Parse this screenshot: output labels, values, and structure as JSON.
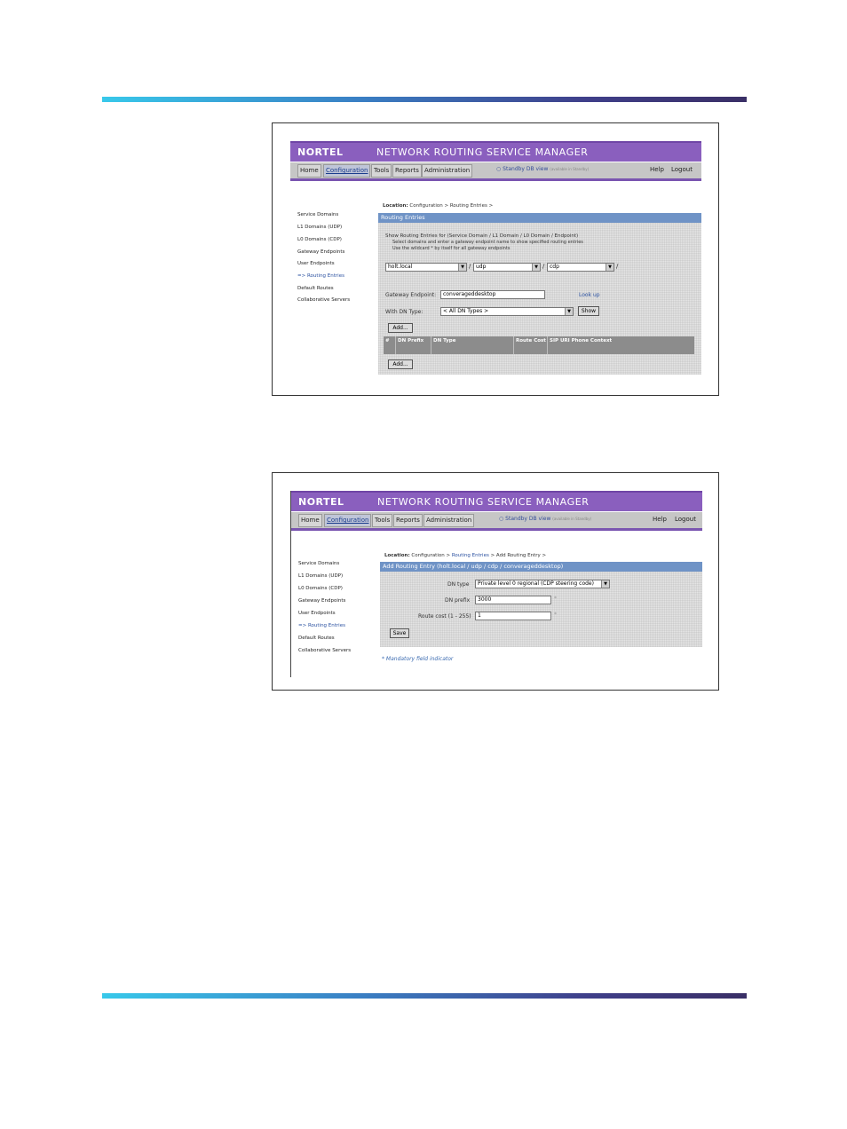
{
  "app": {
    "logo": "NORTEL",
    "title": "NETWORK ROUTING SERVICE MANAGER",
    "menu": [
      "Home",
      "Configuration",
      "Tools",
      "Reports",
      "Administration"
    ],
    "standby": "Standby DB view",
    "standby_note": "(available in Standby)",
    "help": "Help",
    "logout": "Logout",
    "sidebar": [
      "Service Domains",
      "L1 Domains (UDP)",
      "L0 Domains (CDP)",
      "Gateway Endpoints",
      "User Endpoints",
      "=> Routing Entries",
      "Default Routes",
      "Collaborative Servers"
    ]
  },
  "screen1": {
    "location_label": "Location:",
    "location_path": "Configuration > Routing Entries >",
    "panel_title": "Routing Entries",
    "instr1": "Show Routing Entries for (Service Domain / L1 Domain / L0 Domain / Endpoint)",
    "instr2": "Select domains and enter a gateway endpoint name to show specified routing entries",
    "instr3": "Use the wildcard * by itself for all gateway endpoints",
    "service_domain": "holt.local",
    "l1_domain": "udp",
    "l0_domain": "cdp",
    "slash": "/",
    "gateway_label": "Gateway Endpoint:",
    "gateway_value": "converageddesktop",
    "lookup": "Look up",
    "dn_type_label": "With DN Type:",
    "dn_type_value": "< All DN Types >",
    "show_button": "Show",
    "add_button": "Add...",
    "columns": [
      "#",
      "DN Prefix",
      "DN Type",
      "Route Cost",
      "SIP URI Phone Context"
    ]
  },
  "screen2": {
    "location_label": "Location:",
    "location_path1": "Configuration >",
    "location_link": "Routing Entries",
    "location_path2": "> Add Routing Entry >",
    "panel_title": "Add Routing Entry (holt.local / udp / cdp / converageddesktop)",
    "dn_type_label": "DN type",
    "dn_type_value": "Private level 0 regional (CDP steering code)",
    "dn_prefix_label": "DN prefix",
    "dn_prefix_value": "3000",
    "route_cost_label": "Route cost (1 - 255)",
    "route_cost_value": "1",
    "required_mark": "*",
    "save_button": "Save",
    "mandatory_note": "* Mandatory field indicator"
  }
}
